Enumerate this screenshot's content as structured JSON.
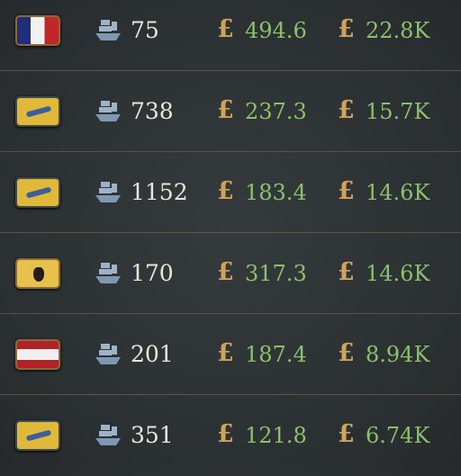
{
  "colors": {
    "value_green": "#8cc06a",
    "currency_gold": "#d1a35a",
    "text": "#ece6d8"
  },
  "icons": {
    "ship": "ship-icon",
    "currency": "pound-icon"
  },
  "rows": [
    {
      "flag": "france",
      "ships": "75",
      "price": "494.6",
      "total": "22.8K"
    },
    {
      "flag": "yellow-banner",
      "ships": "738",
      "price": "237.3",
      "total": "15.7K"
    },
    {
      "flag": "yellow-banner",
      "ships": "1152",
      "price": "183.4",
      "total": "14.6K"
    },
    {
      "flag": "yellow-eagle",
      "ships": "170",
      "price": "317.3",
      "total": "14.6K"
    },
    {
      "flag": "red-white-red",
      "ships": "201",
      "price": "187.4",
      "total": "8.94K"
    },
    {
      "flag": "yellow-banner",
      "ships": "351",
      "price": "121.8",
      "total": "6.74K"
    }
  ],
  "currency_symbol": "£"
}
